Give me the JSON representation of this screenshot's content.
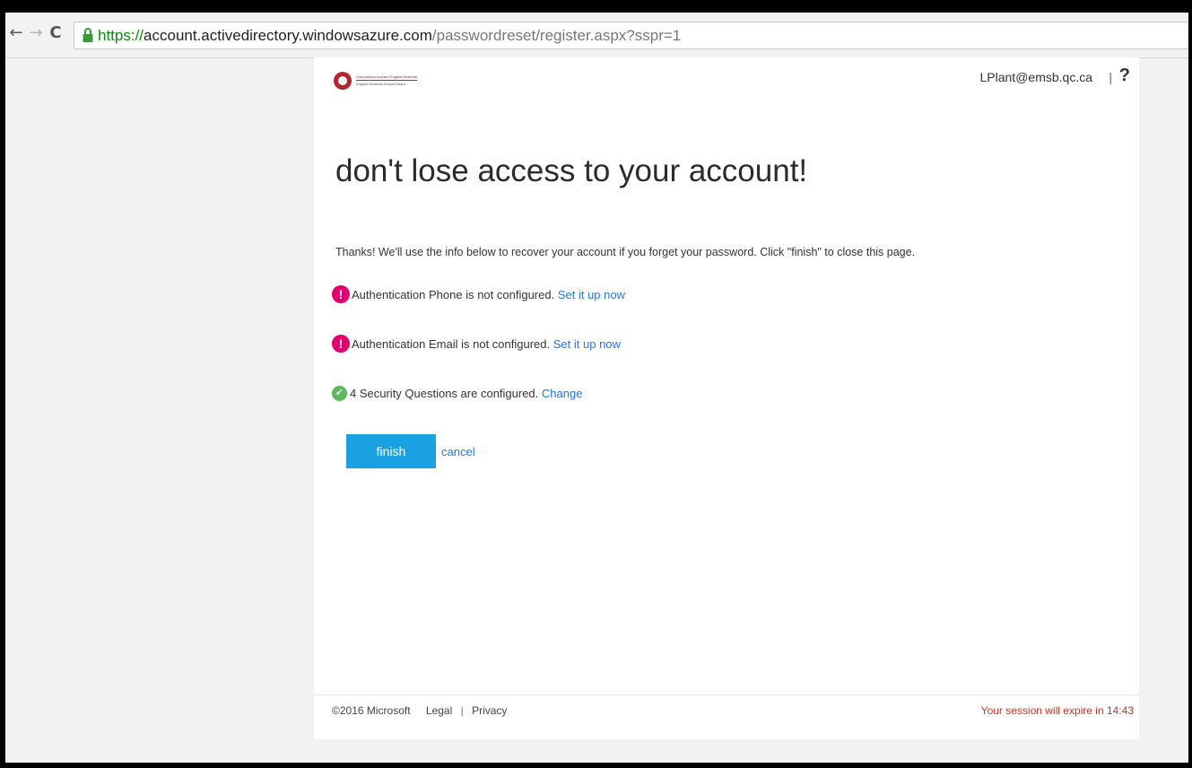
{
  "browser": {
    "url_scheme": "https://",
    "url_host": "account.activedirectory.windowsazure.com",
    "url_path": "/passwordreset/register.aspx?sspr=1",
    "back_glyph": "←",
    "forward_glyph": "→",
    "reload_glyph": "C"
  },
  "header": {
    "logo_line1": "Commission scolaire English-Montréal",
    "logo_line2": "English Montreal School Board",
    "user": "LPlant@emsb.qc.ca",
    "separator": "|",
    "help": "?"
  },
  "main": {
    "title": "don't lose access to your account!",
    "intro": "Thanks! We'll use the info below to recover your account if you forget your password. Click \"finish\" to close this page.",
    "items": [
      {
        "icon": "exclamation-icon",
        "status": "warning",
        "glyph": "!",
        "text": "Authentication Phone is not configured.",
        "link": "Set it up now"
      },
      {
        "icon": "exclamation-icon",
        "status": "warning",
        "glyph": "!",
        "text": "Authentication Email is not configured.",
        "link": "Set it up now"
      },
      {
        "icon": "checkmark-icon",
        "status": "ok",
        "glyph": "✓",
        "text": "4 Security Questions are configured.",
        "link": "Change"
      }
    ],
    "finish_label": "finish",
    "cancel_label": "cancel"
  },
  "footer": {
    "copyright": "©2016 Microsoft",
    "legal": "Legal",
    "separator": "|",
    "privacy": "Privacy",
    "session": "Your session will expire in 14:43"
  },
  "colors": {
    "accent": "#1aa1e1",
    "link": "#2672ec",
    "warning": "#e3006e",
    "ok": "#5cb85c",
    "session": "#c0392b"
  }
}
